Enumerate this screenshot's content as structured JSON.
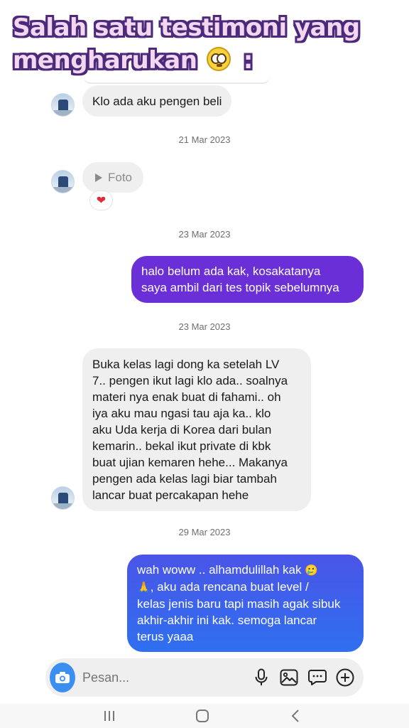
{
  "headline": {
    "line1": "Salah satu testimoni yang",
    "line2": "mengharukan",
    "line2_suffix": ":",
    "emoji_icon": "pleading-face-icon"
  },
  "colors": {
    "incoming_bubble": "#efefef",
    "outgoing_purple": "#6a2fd6",
    "outgoing_blue": "#2f6ff0",
    "reaction_heart": "#e02a3c",
    "camera_button": "#3a8ff0"
  },
  "messages": [
    {
      "type": "incoming",
      "text": "Klo ada aku pengen beli"
    },
    {
      "type": "timestamp",
      "text": "21 Mar 2023"
    },
    {
      "type": "incoming_media",
      "text": "Foto",
      "icon": "play-icon",
      "reaction": "heart-icon"
    },
    {
      "type": "timestamp",
      "text": "23 Mar 2023"
    },
    {
      "type": "outgoing",
      "lines": [
        "halo belum ada kak, kosakatanya",
        "saya ambil dari tes topik sebelumnya"
      ]
    },
    {
      "type": "timestamp",
      "text": "23 Mar 2023"
    },
    {
      "type": "incoming",
      "lines": [
        "Buka kelas lagi dong ka setelah LV",
        "7.. pengen ikut lagi klo ada.. soalnya",
        "materi nya enak buat di fahami.. oh",
        "iya aku mau ngasi tau aja ka.. klo",
        "aku Uda kerja di Korea dari bulan",
        "kemarin.. bekal ikut private di kbk",
        "buat ujian kemaren hehe... Makanya",
        "pengen ada kelas lagi biar tambah",
        "lancar buat percakapan hehe"
      ]
    },
    {
      "type": "timestamp",
      "text": "29 Mar 2023"
    },
    {
      "type": "outgoing",
      "lines": [
        "wah woww .. alhamdulillah kak",
        ", aku ada rencana buat level /",
        "kelas jenis baru tapi masih agak sibuk",
        "akhir-akhir ini kak. semoga lancar",
        "terus yaaa"
      ],
      "emoji_icons": [
        "smiling-face-with-tear-icon",
        "folded-hands-icon"
      ]
    }
  ],
  "composer": {
    "placeholder": "Pesan...",
    "camera_icon": "camera-icon",
    "icons": [
      "microphone-icon",
      "image-icon",
      "sticker-icon",
      "add-icon"
    ]
  },
  "navbar": {
    "icons": [
      "recent-apps-icon",
      "home-icon",
      "back-icon"
    ]
  }
}
